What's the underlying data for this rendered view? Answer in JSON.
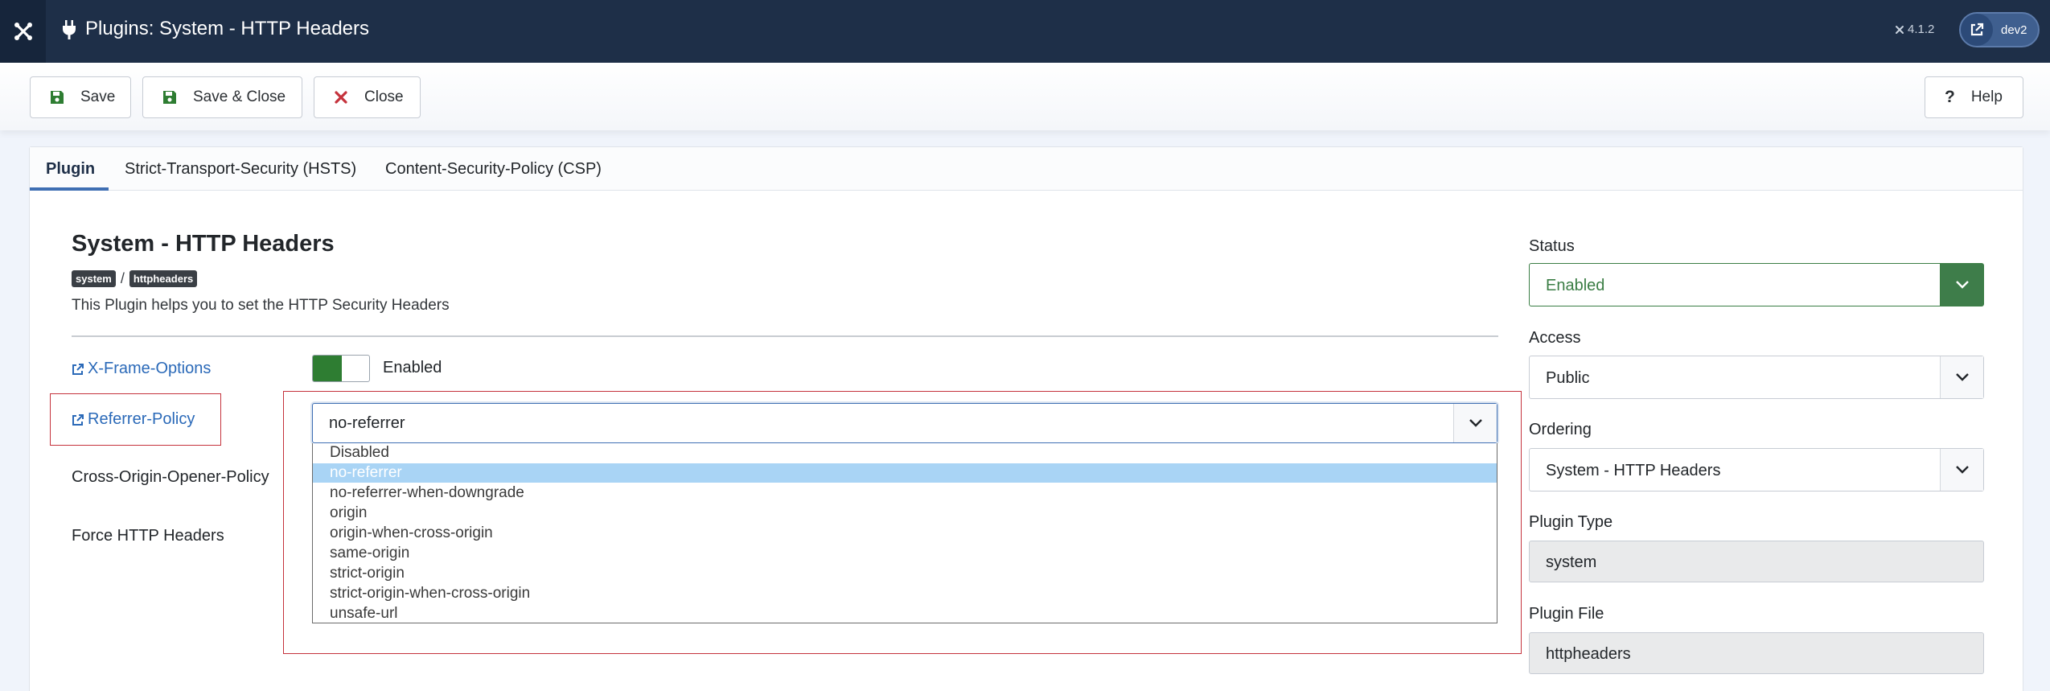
{
  "header": {
    "title": "Plugins: System - HTTP Headers",
    "version": "4.1.2",
    "site_label": "dev2"
  },
  "toolbar": {
    "save_label": "Save",
    "save_close_label": "Save & Close",
    "close_label": "Close",
    "help_label": "Help"
  },
  "tabs": [
    {
      "label": "Plugin",
      "active": true
    },
    {
      "label": "Strict-Transport-Security (HSTS)",
      "active": false
    },
    {
      "label": "Content-Security-Policy (CSP)",
      "active": false
    }
  ],
  "plugin": {
    "title": "System - HTTP Headers",
    "badges": [
      "system",
      "httpheaders"
    ],
    "separator": "/",
    "description": "This Plugin helps you to set the HTTP Security Headers"
  },
  "fields": {
    "x_frame_options": {
      "label": "X-Frame-Options",
      "toggle_text": "Enabled"
    },
    "referrer_policy": {
      "label": "Referrer-Policy",
      "value": "no-referrer",
      "options": [
        "Disabled",
        "no-referrer",
        "no-referrer-when-downgrade",
        "origin",
        "origin-when-cross-origin",
        "same-origin",
        "strict-origin",
        "strict-origin-when-cross-origin",
        "unsafe-url"
      ],
      "highlighted": "no-referrer"
    },
    "coop": {
      "label": "Cross-Origin-Opener-Policy"
    },
    "force": {
      "label": "Force HTTP Headers"
    }
  },
  "sidebar": {
    "status": {
      "label": "Status",
      "value": "Enabled"
    },
    "access": {
      "label": "Access",
      "value": "Public"
    },
    "ordering": {
      "label": "Ordering",
      "value": "System - HTTP Headers"
    },
    "plugin_type": {
      "label": "Plugin Type",
      "value": "system"
    },
    "plugin_file": {
      "label": "Plugin File",
      "value": "httpheaders"
    }
  },
  "colors": {
    "header_bg": "#1e2f48",
    "link": "#2a69b8",
    "success": "#2e7d32",
    "highlight_box": "#c5323c",
    "option_selected": "#a9d4f5"
  }
}
